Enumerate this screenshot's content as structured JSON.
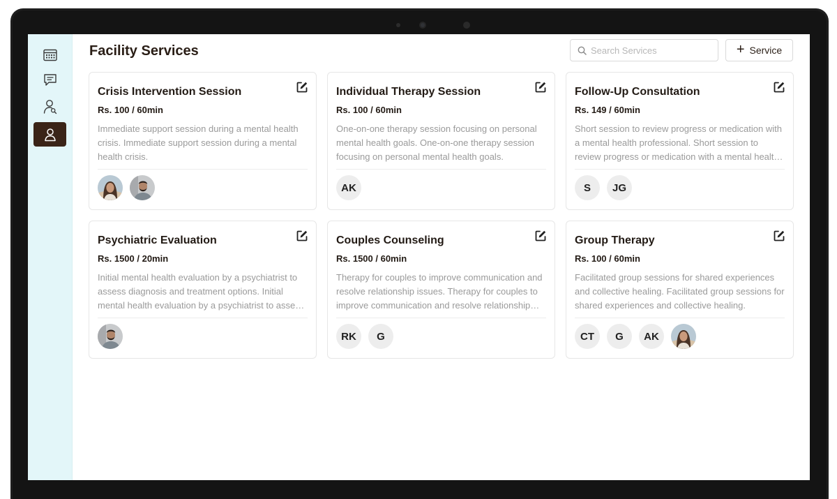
{
  "page": {
    "title": "Facility Services",
    "search_placeholder": "Search Services",
    "add_button_label": "Service"
  },
  "sidebar": {
    "items": [
      {
        "icon": "calendar-icon",
        "active": false
      },
      {
        "icon": "chat-icon",
        "active": false
      },
      {
        "icon": "user-search-icon",
        "active": false
      },
      {
        "icon": "user-icon",
        "active": true
      }
    ]
  },
  "services": [
    {
      "title": "Crisis Intervention Session",
      "price": "Rs. 100 / 60min",
      "description": "Immediate support session during a mental health crisis. Immediate support session during a mental health crisis.",
      "staff": [
        {
          "type": "photo",
          "variant": "woman"
        },
        {
          "type": "photo",
          "variant": "man"
        }
      ]
    },
    {
      "title": "Individual Therapy Session",
      "price": "Rs. 100 / 60min",
      "description": "One-on-one therapy session focusing on personal mental health goals. One-on-one therapy session focusing on personal mental health goals.",
      "staff": [
        {
          "type": "initials",
          "label": "AK"
        }
      ]
    },
    {
      "title": "Follow-Up Consultation",
      "price": "Rs. 149 / 60min",
      "description": "Short session to review progress or medication with a mental health professional. Short session to review progress or medication with a mental health professional.",
      "staff": [
        {
          "type": "initials",
          "label": "S"
        },
        {
          "type": "initials",
          "label": "JG"
        }
      ]
    },
    {
      "title": "Psychiatric Evaluation",
      "price": "Rs. 1500 / 20min",
      "description": "Initial mental health evaluation by a psychiatrist to assess diagnosis and treatment options. Initial mental health evaluation by a psychiatrist to assess diagnosis and treatment options.",
      "staff": [
        {
          "type": "photo",
          "variant": "man"
        }
      ]
    },
    {
      "title": "Couples Counseling",
      "price": "Rs. 1500 / 60min",
      "description": "Therapy for couples to improve communication and resolve relationship issues. Therapy for couples to improve communication and resolve relationship issues.",
      "staff": [
        {
          "type": "initials",
          "label": "RK"
        },
        {
          "type": "initials",
          "label": "G"
        }
      ]
    },
    {
      "title": "Group Therapy",
      "price": "Rs. 100 / 60min",
      "description": "Facilitated group sessions for shared experiences and collective healing. Facilitated group sessions for shared experiences and collective healing.",
      "staff": [
        {
          "type": "initials",
          "label": "CT"
        },
        {
          "type": "initials",
          "label": "G"
        },
        {
          "type": "initials",
          "label": "AK"
        },
        {
          "type": "photo",
          "variant": "woman"
        }
      ]
    }
  ],
  "colors": {
    "sidebar_bg": "#e3f6f9",
    "active_nav": "#3a2418",
    "title_text": "#2a1e16",
    "description_text": "#9a9a9a",
    "avatar_bg": "#ededed"
  }
}
